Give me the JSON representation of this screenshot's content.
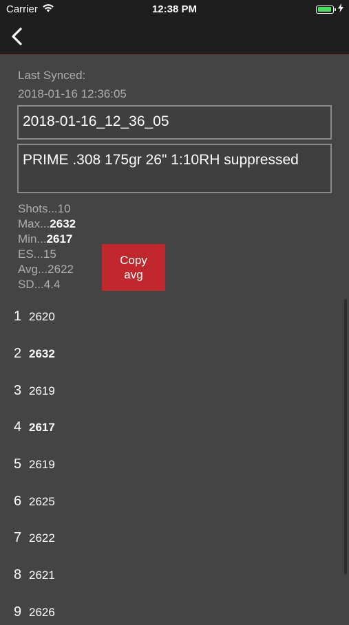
{
  "status": {
    "carrier": "Carrier",
    "time": "12:38 PM"
  },
  "nav": {
    "back_icon": "chevron-left-icon"
  },
  "sync": {
    "label": "Last Synced:",
    "timestamp": "2018-01-16 12:36:05"
  },
  "session": {
    "name_value": "2018-01-16_12_36_05",
    "notes_value": "PRIME .308  175gr 26\" 1:10RH suppressed"
  },
  "stats": {
    "shots_label": "Shots...",
    "shots": "10",
    "max_label": "Max...",
    "max": "2632",
    "min_label": "Min...",
    "min": "2617",
    "es_label": "ES...",
    "es": "15",
    "avg_label": "Avg...",
    "avg": "2622",
    "sd_label": "SD...",
    "sd": "4.4"
  },
  "copy_button": {
    "line1": "Copy",
    "line2": "avg"
  },
  "shots": [
    {
      "num": "1",
      "value": "2620"
    },
    {
      "num": "2",
      "value": "2632"
    },
    {
      "num": "3",
      "value": "2619"
    },
    {
      "num": "4",
      "value": "2617"
    },
    {
      "num": "5",
      "value": "2619"
    },
    {
      "num": "6",
      "value": "2625"
    },
    {
      "num": "7",
      "value": "2622"
    },
    {
      "num": "8",
      "value": "2621"
    },
    {
      "num": "9",
      "value": "2626"
    }
  ],
  "colors": {
    "background": "#444444",
    "bar": "#1e1e1e",
    "accent_red": "#c1282d",
    "battery_green": "#4cd964"
  }
}
